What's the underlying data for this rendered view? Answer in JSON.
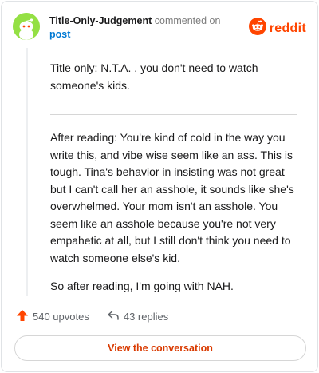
{
  "header": {
    "username": "Title-Only-Judgement",
    "action": "commented on",
    "target": "post",
    "brand": "reddit"
  },
  "comment": {
    "paragraph_1": "Title only: N.T.A. , you don't need to watch someone's kids.",
    "paragraph_2": "After reading: You're kind of cold in the way you write this, and vibe wise seem like an ass. This is tough. Tina's behavior in insisting was not great but I can't call her an asshole, it sounds like she's overwhelmed. Your mom isn't an asshole. You seem like an asshole because you're not very empahetic at all, but I still don't think you need to watch someone else's kid.",
    "paragraph_3": "So after reading, I'm going with NAH."
  },
  "stats": {
    "upvotes": "540 upvotes",
    "replies": "43 replies"
  },
  "cta": {
    "label": "View the conversation"
  },
  "colors": {
    "brand": "#ff4500",
    "link": "#0079d3",
    "cta_text": "#d93a00",
    "avatar_bg": "#94e044"
  },
  "icons": {
    "avatar": "snoo-avatar-icon",
    "logo": "reddit-logo-icon",
    "upvote": "upvote-arrow-icon",
    "reply": "reply-arrow-icon"
  }
}
